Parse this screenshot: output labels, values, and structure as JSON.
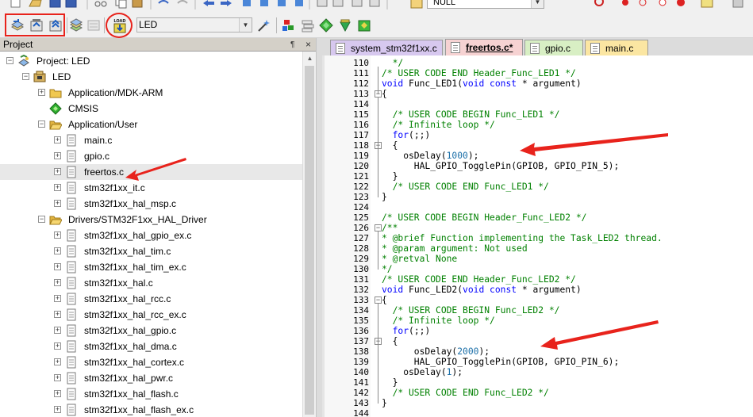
{
  "toolbar": {
    "null_label": "NULL",
    "target_name": "LED",
    "load_label": "LOAD"
  },
  "project": {
    "header": "Project",
    "pin_glyph": "¶",
    "close_glyph": "×",
    "rows": [
      {
        "label": "Project: LED",
        "indent": 0,
        "expander": "-",
        "icon": "project"
      },
      {
        "label": "LED",
        "indent": 1,
        "expander": "-",
        "icon": "target"
      },
      {
        "label": "Application/MDK-ARM",
        "indent": 2,
        "expander": "+",
        "icon": "folder"
      },
      {
        "label": "CMSIS",
        "indent": 2,
        "expander": "",
        "icon": "diamond"
      },
      {
        "label": "Application/User",
        "indent": 2,
        "expander": "-",
        "icon": "folder-open"
      },
      {
        "label": "main.c",
        "indent": 3,
        "expander": "+",
        "icon": "file"
      },
      {
        "label": "gpio.c",
        "indent": 3,
        "expander": "+",
        "icon": "file"
      },
      {
        "label": "freertos.c",
        "indent": 3,
        "expander": "+",
        "icon": "file",
        "selected": true
      },
      {
        "label": "stm32f1xx_it.c",
        "indent": 3,
        "expander": "+",
        "icon": "file"
      },
      {
        "label": "stm32f1xx_hal_msp.c",
        "indent": 3,
        "expander": "+",
        "icon": "file"
      },
      {
        "label": "Drivers/STM32F1xx_HAL_Driver",
        "indent": 2,
        "expander": "-",
        "icon": "folder-open"
      },
      {
        "label": "stm32f1xx_hal_gpio_ex.c",
        "indent": 3,
        "expander": "+",
        "icon": "file"
      },
      {
        "label": "stm32f1xx_hal_tim.c",
        "indent": 3,
        "expander": "+",
        "icon": "file"
      },
      {
        "label": "stm32f1xx_hal_tim_ex.c",
        "indent": 3,
        "expander": "+",
        "icon": "file"
      },
      {
        "label": "stm32f1xx_hal.c",
        "indent": 3,
        "expander": "+",
        "icon": "file"
      },
      {
        "label": "stm32f1xx_hal_rcc.c",
        "indent": 3,
        "expander": "+",
        "icon": "file"
      },
      {
        "label": "stm32f1xx_hal_rcc_ex.c",
        "indent": 3,
        "expander": "+",
        "icon": "file"
      },
      {
        "label": "stm32f1xx_hal_gpio.c",
        "indent": 3,
        "expander": "+",
        "icon": "file"
      },
      {
        "label": "stm32f1xx_hal_dma.c",
        "indent": 3,
        "expander": "+",
        "icon": "file"
      },
      {
        "label": "stm32f1xx_hal_cortex.c",
        "indent": 3,
        "expander": "+",
        "icon": "file"
      },
      {
        "label": "stm32f1xx_hal_pwr.c",
        "indent": 3,
        "expander": "+",
        "icon": "file"
      },
      {
        "label": "stm32f1xx_hal_flash.c",
        "indent": 3,
        "expander": "+",
        "icon": "file"
      },
      {
        "label": "stm32f1xx_hal_flash_ex.c",
        "indent": 3,
        "expander": "+",
        "icon": "file"
      }
    ]
  },
  "tabs": [
    {
      "label": "system_stm32f1xx.c",
      "color": "#d7c8ef",
      "active": false
    },
    {
      "label": "freertos.c*",
      "color": "#f6d2d2",
      "active": true
    },
    {
      "label": "gpio.c",
      "color": "#d8efc4",
      "active": false
    },
    {
      "label": "main.c",
      "color": "#fbe6a2",
      "active": false
    }
  ],
  "editor": {
    "lines": [
      {
        "n": "110",
        "segs": [
          [
            "cm",
            "  */"
          ]
        ]
      },
      {
        "n": "111",
        "segs": [
          [
            "cm",
            "/* USER CODE END Header_Func_LED1 */"
          ]
        ]
      },
      {
        "n": "112",
        "segs": [
          [
            "kw",
            "void"
          ],
          [
            "",
            " Func_LED1("
          ],
          [
            "kw",
            "void const"
          ],
          [
            "",
            " * argument)"
          ]
        ]
      },
      {
        "n": "113",
        "segs": [
          [
            "",
            "{"
          ]
        ],
        "fold": "-"
      },
      {
        "n": "114",
        "segs": [
          [
            "",
            ""
          ]
        ]
      },
      {
        "n": "115",
        "segs": [
          [
            "cm",
            "  /* USER CODE BEGIN Func_LED1 */"
          ]
        ]
      },
      {
        "n": "116",
        "segs": [
          [
            "cm",
            "  /* Infinite loop */"
          ]
        ]
      },
      {
        "n": "117",
        "segs": [
          [
            "kw",
            "  for"
          ],
          [
            "",
            "(;;)"
          ]
        ]
      },
      {
        "n": "118",
        "segs": [
          [
            "",
            "  {"
          ]
        ],
        "fold": "-"
      },
      {
        "n": "119",
        "segs": [
          [
            "",
            "    osDelay("
          ],
          [
            "num",
            "1000"
          ],
          [
            "",
            ");"
          ]
        ]
      },
      {
        "n": "120",
        "segs": [
          [
            "",
            "      HAL_GPIO_TogglePin(GPIOB, GPIO_PIN_5);"
          ]
        ]
      },
      {
        "n": "121",
        "segs": [
          [
            "",
            "  }"
          ]
        ]
      },
      {
        "n": "122",
        "segs": [
          [
            "cm",
            "  /* USER CODE END Func_LED1 */"
          ]
        ]
      },
      {
        "n": "123",
        "segs": [
          [
            "",
            "}"
          ]
        ]
      },
      {
        "n": "124",
        "segs": [
          [
            "",
            ""
          ]
        ]
      },
      {
        "n": "125",
        "segs": [
          [
            "cm",
            "/* USER CODE BEGIN Header_Func_LED2 */"
          ]
        ]
      },
      {
        "n": "126",
        "segs": [
          [
            "cm",
            "/**"
          ]
        ],
        "fold": "-"
      },
      {
        "n": "127",
        "segs": [
          [
            "cm",
            "* @brief Function implementing the Task_LED2 thread."
          ]
        ]
      },
      {
        "n": "128",
        "segs": [
          [
            "cm",
            "* @param argument: Not used"
          ]
        ]
      },
      {
        "n": "129",
        "segs": [
          [
            "cm",
            "* @retval None"
          ]
        ]
      },
      {
        "n": "130",
        "segs": [
          [
            "cm",
            "*/"
          ]
        ]
      },
      {
        "n": "131",
        "segs": [
          [
            "cm",
            "/* USER CODE END Header_Func_LED2 */"
          ]
        ]
      },
      {
        "n": "132",
        "segs": [
          [
            "kw",
            "void"
          ],
          [
            "",
            " Func_LED2("
          ],
          [
            "kw",
            "void const"
          ],
          [
            "",
            " * argument)"
          ]
        ]
      },
      {
        "n": "133",
        "segs": [
          [
            "",
            "{"
          ]
        ],
        "fold": "-"
      },
      {
        "n": "134",
        "segs": [
          [
            "cm",
            "  /* USER CODE BEGIN Func_LED2 */"
          ]
        ]
      },
      {
        "n": "135",
        "segs": [
          [
            "cm",
            "  /* Infinite loop */"
          ]
        ]
      },
      {
        "n": "136",
        "segs": [
          [
            "kw",
            "  for"
          ],
          [
            "",
            "(;;)"
          ]
        ]
      },
      {
        "n": "137",
        "segs": [
          [
            "",
            "  {"
          ]
        ],
        "fold": "-"
      },
      {
        "n": "138",
        "segs": [
          [
            "",
            "      osDelay("
          ],
          [
            "num",
            "2000"
          ],
          [
            "",
            ");"
          ]
        ]
      },
      {
        "n": "139",
        "segs": [
          [
            "",
            "      HAL_GPIO_TogglePin(GPIOB, GPIO_PIN_6);"
          ]
        ]
      },
      {
        "n": "140",
        "segs": [
          [
            "",
            "    osDelay("
          ],
          [
            "num",
            "1"
          ],
          [
            "",
            ");"
          ]
        ]
      },
      {
        "n": "141",
        "segs": [
          [
            "",
            "  }"
          ]
        ]
      },
      {
        "n": "142",
        "segs": [
          [
            "cm",
            "  /* USER CODE END Func_LED2 */"
          ]
        ]
      },
      {
        "n": "143",
        "segs": [
          [
            "",
            "}"
          ]
        ]
      },
      {
        "n": "144",
        "segs": [
          [
            "",
            ""
          ]
        ]
      }
    ]
  },
  "colors": {
    "annotation_red": "#e8231c",
    "comment": "#008000",
    "keyword": "#0000ff",
    "number": "#1b6fa8"
  }
}
